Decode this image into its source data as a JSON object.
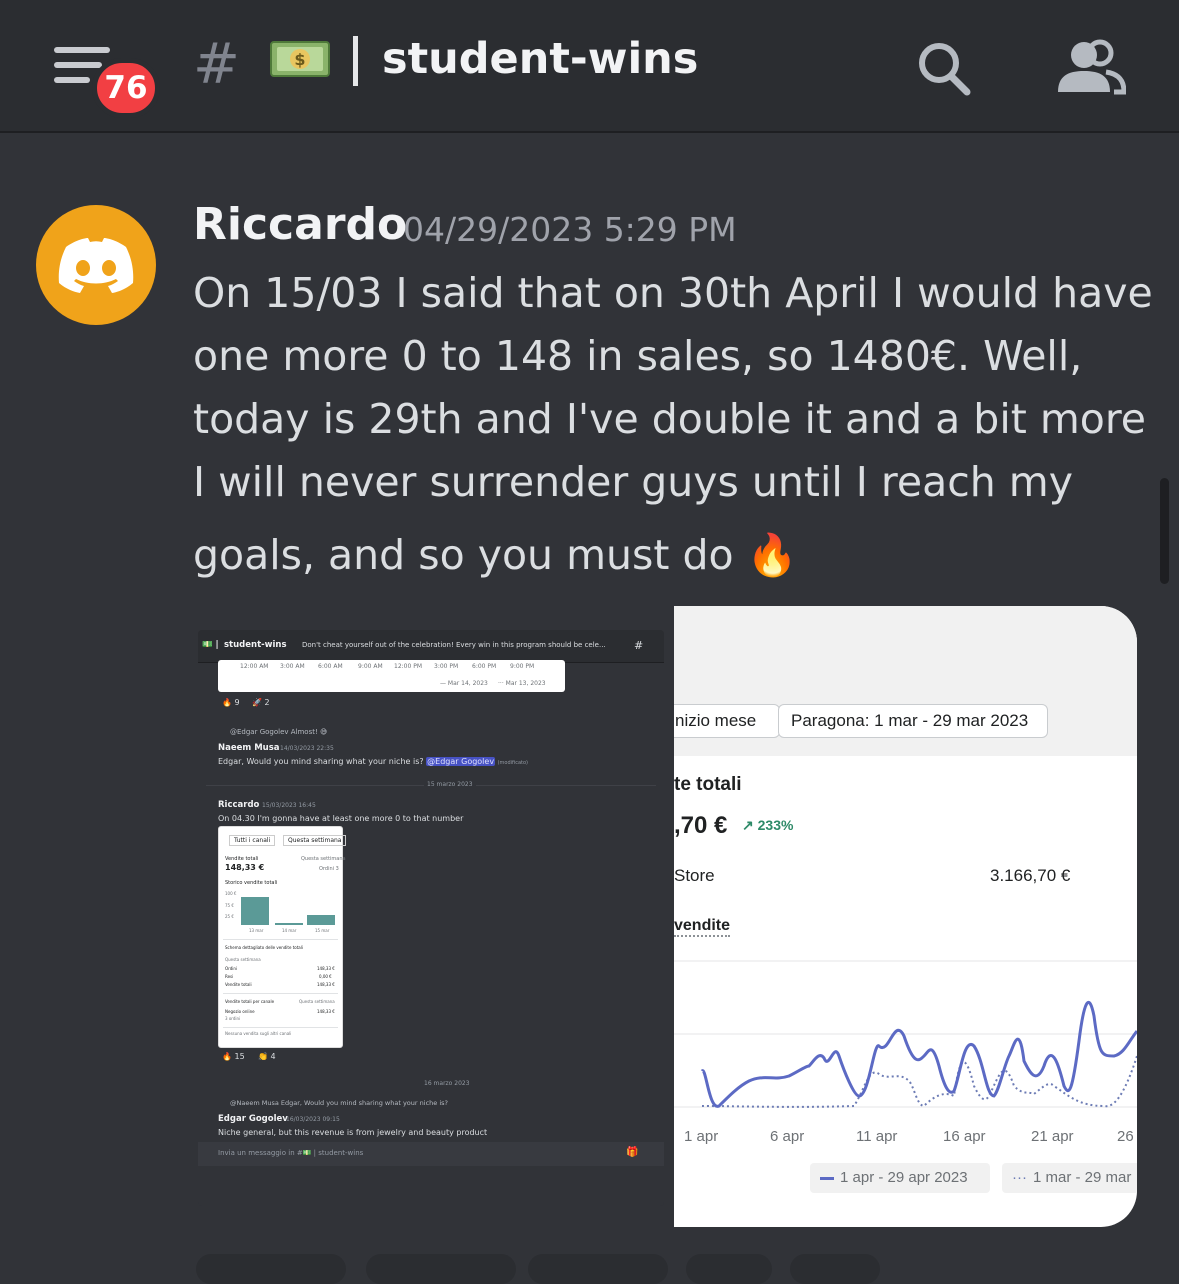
{
  "header": {
    "unread_count": "76",
    "channel_emoji": "💵",
    "channel_name": "student-wins"
  },
  "message": {
    "author": "Riccardo",
    "timestamp": "04/29/2023 5:29 PM",
    "lines": [
      "On 15/03 I said that on 30th April I would have",
      "one more 0 to 148 in sales, so 1480€. Well,",
      "today is 29th and I've double it and a bit more",
      "I will never surrender guys until I reach my",
      "goals, and so you must do 🔥"
    ]
  },
  "attachment1": {
    "channel": "student-wins",
    "topic": "Don't cheat yourself out of the celebration! Every win in this program should be cele...",
    "time_ticks": [
      "12:00 AM",
      "3:00 AM",
      "6:00 AM",
      "9:00 AM",
      "12:00 PM",
      "3:00 PM",
      "6:00 PM",
      "9:00 PM"
    ],
    "legend": [
      "Mar 14, 2023",
      "Mar 13, 2023"
    ],
    "reactions_a": [
      "🔥 9",
      "🚀 2"
    ],
    "reply_a": "@Edgar Gogolev Almost! 😅",
    "msg_a_author": "Naeem Musa",
    "msg_a_time": "14/03/2023 22:35",
    "msg_a_text": "Edgar, Would you mind sharing what your niche is?",
    "msg_a_mention": "@Edgar Gogolev",
    "edited": "(modificato)",
    "divider_1": "15 marzo 2023",
    "msg_b_author": "Riccardo",
    "msg_b_time": "15/03/2023 16:45",
    "msg_b_text": "On 04.30 I'm gonna have at least one more 0 to that number",
    "card": {
      "btn1": "Tutti i canali",
      "btn2": "Questa settimana",
      "title": "Vendite totali",
      "period": "Questa settimana",
      "value": "148,33 €",
      "orders": "Ordini 3",
      "chart_title": "Storico vendite totali",
      "y_ticks": [
        "100 €",
        "75 €",
        "25 €"
      ],
      "x_ticks": [
        "13 mar",
        "14 mar",
        "15 mar"
      ],
      "breakdown_title": "Schema dettagliato delle vendite totali",
      "breakdown_period": "Questa settimana",
      "rows": [
        [
          "Ordini",
          "148,33 €"
        ],
        [
          "Resi",
          "0,00 €"
        ],
        [
          "Vendite totali",
          "148,33 €"
        ]
      ],
      "channel_title": "Vendite totali per canale",
      "channel_period": "Questa settimana",
      "channel_row": [
        "Negozio online",
        "148,33 €"
      ],
      "channel_sub": "3 ordini",
      "footer": "Nessuna vendita sugli altri canali"
    },
    "reactions_b": [
      "🔥 15",
      "👏 4"
    ],
    "divider_2": "16 marzo 2023",
    "reply_b": "@Naeem Musa Edgar, Would you mind sharing what your niche is?",
    "msg_c_author": "Edgar Gogolev",
    "msg_c_time": "16/03/2023 09:15",
    "msg_c_text": "Niche general, but this revenue is from jewelry and beauty product",
    "input_placeholder": "Invia un messaggio in #💵 | student-wins"
  },
  "attachment2": {
    "btn_left": "nizio mese",
    "btn_compare": "Paragona: 1 mar - 29 mar 2023",
    "title": "te totali",
    "value": ",70 €",
    "change": "↗ 233%",
    "row_label": "Store",
    "row_value": "3.166,70 €",
    "section": "vendite",
    "x_ticks": [
      "1 apr",
      "6 apr",
      "11 apr",
      "16 apr",
      "21 apr",
      "26"
    ],
    "legend_current": "1 apr - 29 apr 2023",
    "legend_previous": "1 mar - 29 mar",
    "colors": {
      "current": "#5c6ac4",
      "previous": "#6d7cb5"
    }
  }
}
